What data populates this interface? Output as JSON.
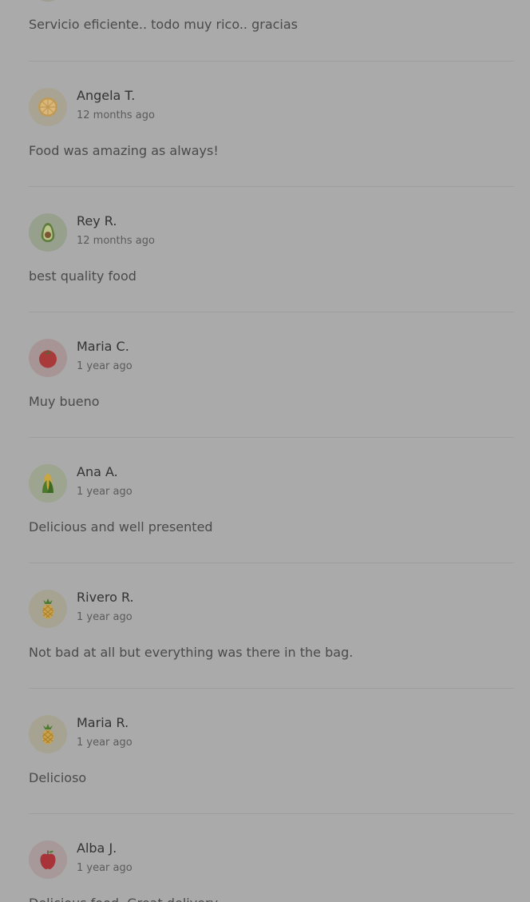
{
  "top_review": {
    "comment": "Servicio eficiente.. todo muy rico.. gracias"
  },
  "reviews": [
    {
      "name": "Angela T.",
      "time": "12 months ago",
      "comment": "Food was amazing as always!",
      "avatar_icon": "orange-slice-icon",
      "avatar_bg": "#a8a392"
    },
    {
      "name": "Rey R.",
      "time": "12 months ago",
      "comment": "best quality food",
      "avatar_icon": "avocado-icon",
      "avatar_bg": "#96a08d"
    },
    {
      "name": "Maria C.",
      "time": "1 year ago",
      "comment": "Muy bueno",
      "avatar_icon": "tomato-icon",
      "avatar_bg": "#a79595"
    },
    {
      "name": "Ana A.",
      "time": "1 year ago",
      "comment": "Delicious and well presented",
      "avatar_icon": "corn-icon",
      "avatar_bg": "#9da48f"
    },
    {
      "name": "Rivero R.",
      "time": "1 year ago",
      "comment": "Not bad at all but everything was there in the bag.",
      "avatar_icon": "pineapple-icon",
      "avatar_bg": "#a7a393"
    },
    {
      "name": "Maria R.",
      "time": "1 year ago",
      "comment": "Delicioso",
      "avatar_icon": "pineapple-icon",
      "avatar_bg": "#a7a393"
    },
    {
      "name": "Alba J.",
      "time": "1 year ago",
      "comment": "Delicious food. Great delivery",
      "avatar_icon": "apple-icon",
      "avatar_bg": "#a79999"
    }
  ]
}
